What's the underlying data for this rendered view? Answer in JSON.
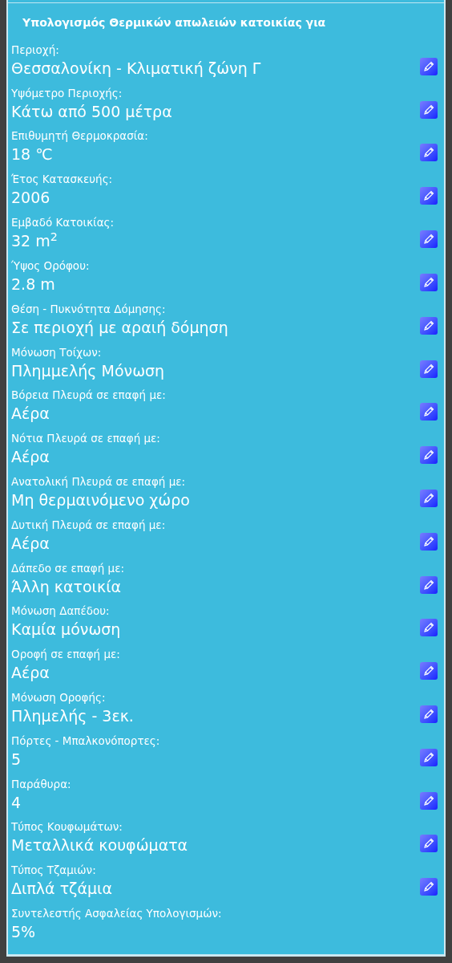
{
  "title": "Υπολογισμός Θερμικών απωλειών κατοικίας για",
  "fields": [
    {
      "label": "Περιοχή:",
      "value": "Θεσσαλονίκη - Κλιματική ζώνη Γ",
      "editable": true
    },
    {
      "label": "Υψόμετρο Περιοχής:",
      "value": "Κάτω από 500 μέτρα",
      "editable": true
    },
    {
      "label": "Επιθυμητή Θερμοκρασία:",
      "value": "18 ℃",
      "editable": true
    },
    {
      "label": "Έτος Κατασκευής:",
      "value": "2006",
      "editable": true
    },
    {
      "label": "Εμβαδό Κατοικίας:",
      "value": "32 m$^{2}$",
      "editable": true
    },
    {
      "label": "Ύψος Ορόφου:",
      "value": "2.8 m",
      "editable": true
    },
    {
      "label": "Θέση - Πυκνότητα Δόμησης:",
      "value": "Σε περιοχή με αραιή δόμηση",
      "editable": true
    },
    {
      "label": "Μόνωση Τοίχων:",
      "value": "Πλημμελής Μόνωση",
      "editable": true
    },
    {
      "label": "Βόρεια Πλευρά σε επαφή με:",
      "value": "Αέρα",
      "editable": true
    },
    {
      "label": "Νότια Πλευρά σε επαφή με:",
      "value": "Αέρα",
      "editable": true
    },
    {
      "label": "Ανατολική Πλευρά σε επαφή με:",
      "value": "Μη θερμαινόμενο χώρο",
      "editable": true
    },
    {
      "label": "Δυτική Πλευρά σε επαφή με:",
      "value": "Αέρα",
      "editable": true
    },
    {
      "label": "Δάπεδο σε επαφή με:",
      "value": "Άλλη κατοικία",
      "editable": true
    },
    {
      "label": "Μόνωση Δαπέδου:",
      "value": "Καμία μόνωση",
      "editable": true
    },
    {
      "label": "Οροφή σε επαφή με:",
      "value": "Αέρα",
      "editable": true
    },
    {
      "label": "Μόνωση Οροφής:",
      "value": "Πλημελής - 3εκ.",
      "editable": true
    },
    {
      "label": "Πόρτες - Μπαλκονόπορτες:",
      "value": "5",
      "editable": true
    },
    {
      "label": "Παράθυρα:",
      "value": "4",
      "editable": true
    },
    {
      "label": "Τύπος Κουφωμάτων:",
      "value": "Μεταλλικά κουφώματα",
      "editable": true
    },
    {
      "label": "Τύπος Τζαμιών:",
      "value": "Διπλά τζάμια",
      "editable": true
    },
    {
      "label": "Συντελεστής Ασφαλείας Υπολογισμών:",
      "value": "5%",
      "editable": false
    }
  ]
}
